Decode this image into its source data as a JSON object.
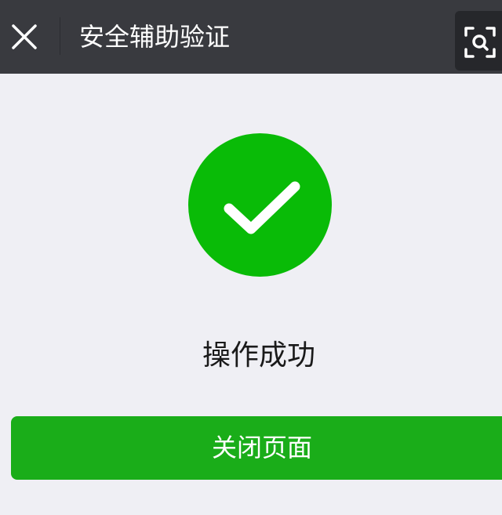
{
  "navbar": {
    "title": "安全辅助验证",
    "close_icon": "close-icon",
    "scan_icon": "scan-icon",
    "background_color": "#393a3f"
  },
  "result": {
    "icon": "checkmark-icon",
    "message": "操作成功",
    "success_color": "#09bb07"
  },
  "actions": {
    "close_page_label": "关闭页面",
    "button_color": "#1aad19"
  }
}
